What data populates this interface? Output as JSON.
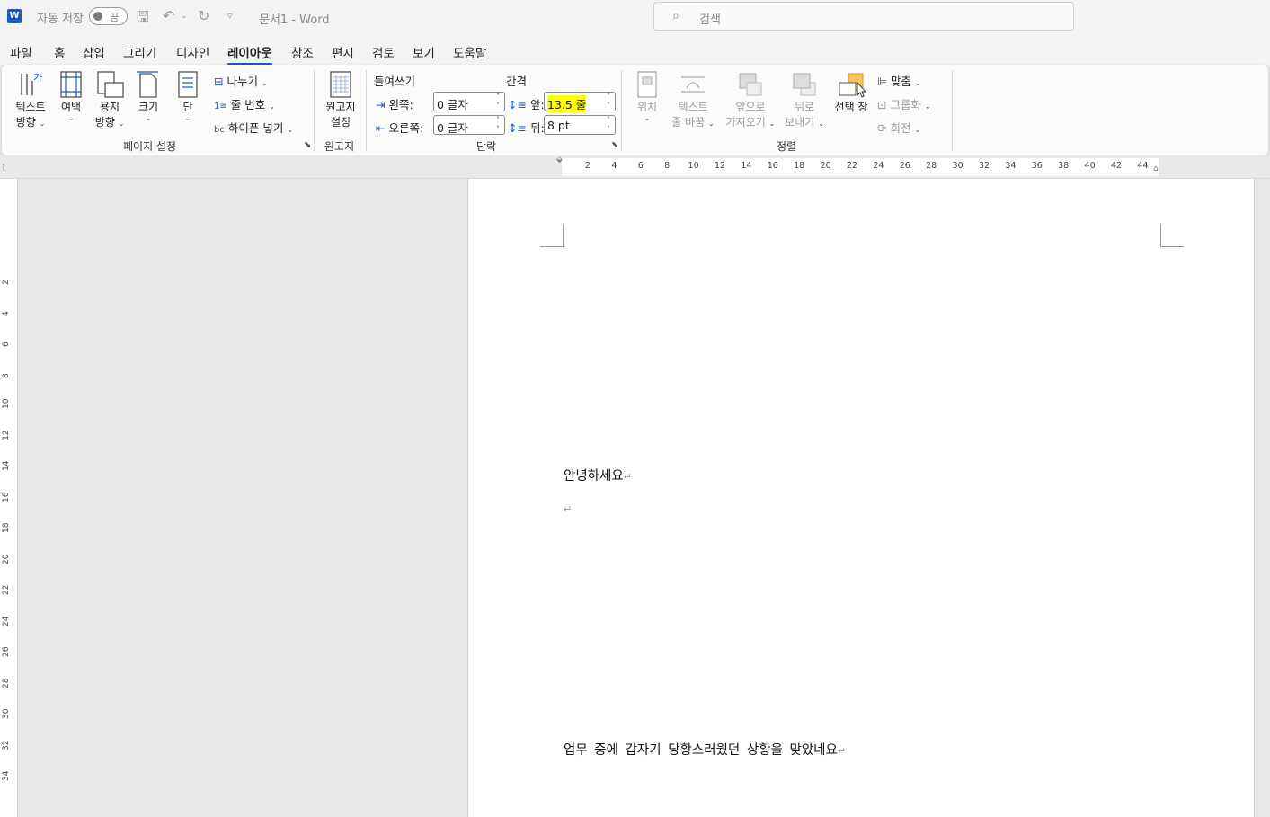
{
  "titlebar": {
    "app_icon_letter": "W",
    "autosave_label": "자동 저장",
    "autosave_state": "끔",
    "doc_title": "문서1  -  Word",
    "search_placeholder": "검색"
  },
  "menu": {
    "tabs": [
      "파일",
      "홈",
      "삽입",
      "그리기",
      "디자인",
      "레이아웃",
      "참조",
      "편지",
      "검토",
      "보기",
      "도움말"
    ],
    "active_tab": "레이아웃"
  },
  "ribbon": {
    "page_setup": {
      "text_direction_1": "텍스트",
      "text_direction_2": "방향",
      "margins": "여백",
      "orientation_1": "용지",
      "orientation_2": "방향",
      "size": "크기",
      "columns": "단",
      "breaks": "나누기",
      "line_numbers": "줄 번호",
      "hyphenation": "하이픈 넣기",
      "group_label": "페이지 설정"
    },
    "manuscript": {
      "settings_1": "원고지",
      "settings_2": "설정",
      "group_label": "원고지"
    },
    "paragraph": {
      "indent_header": "들여쓰기",
      "spacing_header": "간격",
      "left_label": "왼쪽:",
      "left_value": "0 글자",
      "right_label": "오른쪽:",
      "right_value": "0 글자",
      "before_label": "앞:",
      "before_value": "13.5 줄",
      "after_label": "뒤:",
      "after_value": "8 pt",
      "group_label": "단락"
    },
    "arrange": {
      "position": "위치",
      "wrap_1": "텍스트",
      "wrap_2": "줄 바꿈",
      "forward_1": "앞으로",
      "forward_2": "가져오기",
      "backward_1": "뒤로",
      "backward_2": "보내기",
      "selection_pane": "선택 창",
      "align": "맞춤",
      "group": "그룹화",
      "rotate": "회전",
      "group_label": "정렬"
    }
  },
  "ruler": {
    "ticks": [
      "2",
      "4",
      "6",
      "8",
      "10",
      "12",
      "14",
      "16",
      "18",
      "20",
      "22",
      "24",
      "26",
      "28",
      "30",
      "32",
      "34",
      "36",
      "38",
      "40",
      "42",
      "44"
    ],
    "vticks": [
      "2",
      "4",
      "6",
      "8",
      "10",
      "12",
      "14",
      "16",
      "18",
      "20",
      "22",
      "24",
      "26",
      "28",
      "30",
      "32",
      "34"
    ]
  },
  "document": {
    "paragraph_1": "안녕하세요",
    "paragraph_2": "",
    "paragraph_3": "업무 중에 갑자기 당황스러웠던 상황을 맞았네요",
    "paragraph_mark": "↵"
  },
  "colors": {
    "accent": "#185abd",
    "highlight": "#ffff00"
  }
}
